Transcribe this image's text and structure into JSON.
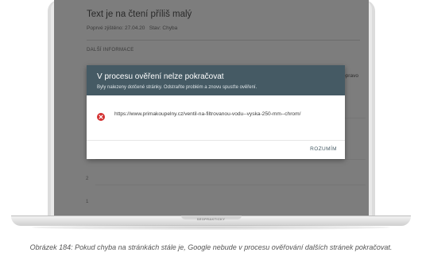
{
  "background_page": {
    "title": "Text je na čtení příliš malý",
    "first_detected_label": "Poprvé zjištěno: 27.04.20",
    "status_label": "Stav: Chyba",
    "section_heading": "DALŠÍ INFORMACE",
    "right_partial_text": "s opravo",
    "chart_ticks": [
      "2",
      "1"
    ]
  },
  "dialog": {
    "title": "V procesu ověření nelze pokračovat",
    "description": "Byly nalezeny dotčené stránky. Odstraňte problém a znovu spusťte ověření.",
    "url": "https://www.primakoupelny.cz/ventil-na-filtrovanou-vodu--vyska-250-mm--chrom/",
    "button_label": "ROZUMÍM",
    "header_color": "#455a64",
    "error_color": "#d32f2f"
  },
  "laptop": {
    "base_logo_text": "SEOPRAKTICKY"
  },
  "caption": "Obrázek 184: Pokud chyba na stránkách stále je, Google nebude v procesu ověřování dalších stránek pokračovat."
}
